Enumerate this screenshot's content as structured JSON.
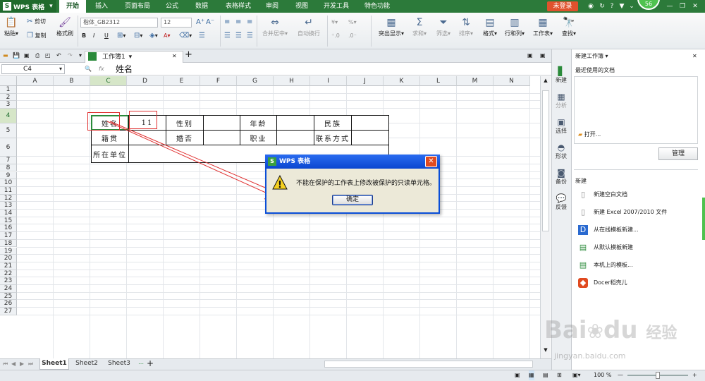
{
  "app": {
    "name": "WPS 表格",
    "logo": "S"
  },
  "menu_tabs": [
    "开始",
    "插入",
    "页面布局",
    "公式",
    "数据",
    "表格样式",
    "审阅",
    "视图",
    "开发工具",
    "特色功能"
  ],
  "active_tab": "开始",
  "login_label": "未登录",
  "avatar_badge": "56",
  "ribbon": {
    "paste": "粘贴",
    "cut": "剪切",
    "copy": "复制",
    "format_painter": "格式刷",
    "font_name": "楷体_GB2312",
    "font_size": "12",
    "merge_center": "合并居中",
    "auto_wrap": "自动换行",
    "highlight": "突出显示",
    "sum": "求和",
    "filter": "筛选",
    "sort": "排序",
    "format": "格式",
    "rows_cols": "行和列",
    "worksheet": "工作表",
    "find": "查找",
    "percent": "%"
  },
  "doc_tab": {
    "title": "工作簿1"
  },
  "formula_bar": {
    "name_box": "C4",
    "fx": "fx",
    "value": "姓名"
  },
  "columns": [
    "A",
    "B",
    "C",
    "D",
    "E",
    "F",
    "G",
    "H",
    "I",
    "J",
    "K",
    "L",
    "M",
    "N"
  ],
  "rows": [
    "1",
    "2",
    "3",
    "4",
    "5",
    "6",
    "7",
    "8",
    "9",
    "10",
    "11",
    "12",
    "13",
    "14",
    "15",
    "16",
    "17",
    "18",
    "19",
    "20",
    "21",
    "22",
    "23",
    "24",
    "25",
    "26",
    "27"
  ],
  "form": {
    "r4": [
      "姓名",
      "11",
      "性别",
      "",
      "年龄",
      "",
      "民族",
      ""
    ],
    "r5": [
      "籍贯",
      "",
      "婚否",
      "",
      "职业",
      "",
      "联系方式",
      ""
    ],
    "r6": [
      "所在单位",
      ""
    ]
  },
  "sheets": [
    "Sheet1",
    "Sheet2",
    "Sheet3"
  ],
  "active_sheet": "Sheet1",
  "status": {
    "zoom": "100 %"
  },
  "sidebar": {
    "items": [
      "新建",
      "分析",
      "选择",
      "形状",
      "备份",
      "反馈"
    ]
  },
  "panel": {
    "title": "新建工作簿",
    "recent_label": "最近使用的文档",
    "open_label": "打开...",
    "manage_label": "管理",
    "new_section": "新建",
    "links": [
      "新建空白文档",
      "新建 Excel 2007/2010 文件",
      "从在线模板新建...",
      "从默认模板新建",
      "本机上的模板...",
      "Docer稻壳儿"
    ]
  },
  "dialog": {
    "title": "WPS 表格",
    "message": "不能在保护的工作表上修改被保护的只读单元格。",
    "ok": "确定"
  },
  "watermark": {
    "text1": "Bai",
    "text2": "du",
    "text3": "经验",
    "url": "jingyan.baidu.com"
  },
  "colors": {
    "brand": "#2c7a3a",
    "dialog_title": "#0a46d0",
    "login": "#e0522d",
    "annotation": "#e03030"
  }
}
